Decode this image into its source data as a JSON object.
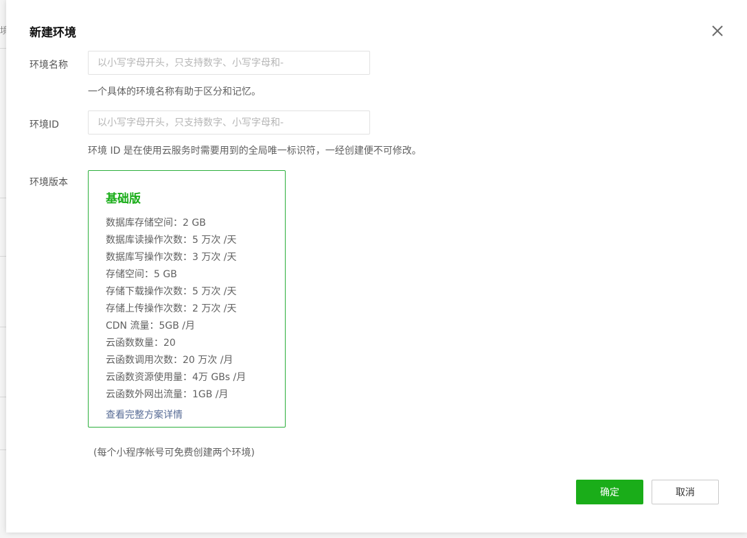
{
  "background": {
    "snippet": "境"
  },
  "dialog": {
    "title": "新建环境",
    "close_icon": "close-icon"
  },
  "form": {
    "name": {
      "label": "环境名称",
      "placeholder": "以小写字母开头，只支持数字、小写字母和-",
      "value": "",
      "hint": "一个具体的环境名称有助于区分和记忆。"
    },
    "env_id": {
      "label": "环境ID",
      "placeholder": "以小写字母开头，只支持数字、小写字母和-",
      "value": "",
      "hint": "环境 ID 是在使用云服务时需要用到的全局唯一标识符，一经创建便不可修改。"
    },
    "version": {
      "label": "环境版本",
      "plan": {
        "name": "基础版",
        "features": [
          "数据库存储空间：2 GB",
          "数据库读操作次数：5 万次 /天",
          "数据库写操作次数：3 万次 /天",
          "存储空间：5 GB",
          "存储下载操作次数：5 万次 /天",
          "存储上传操作次数：2 万次 /天",
          "CDN 流量：5GB /月",
          "云函数数量：20",
          "云函数调用次数：20 万次 /月",
          "云函数资源使用量：4万 GBs /月",
          "云函数外网出流量：1GB /月"
        ],
        "details_link": "查看完整方案详情"
      }
    }
  },
  "footnote": "(每个小程序帐号可免费创建两个环境)",
  "buttons": {
    "confirm": "确定",
    "cancel": "取消"
  },
  "colors": {
    "primary_green": "#1aad19",
    "link_blue": "#576b95",
    "card_border": "#2aae3a"
  }
}
